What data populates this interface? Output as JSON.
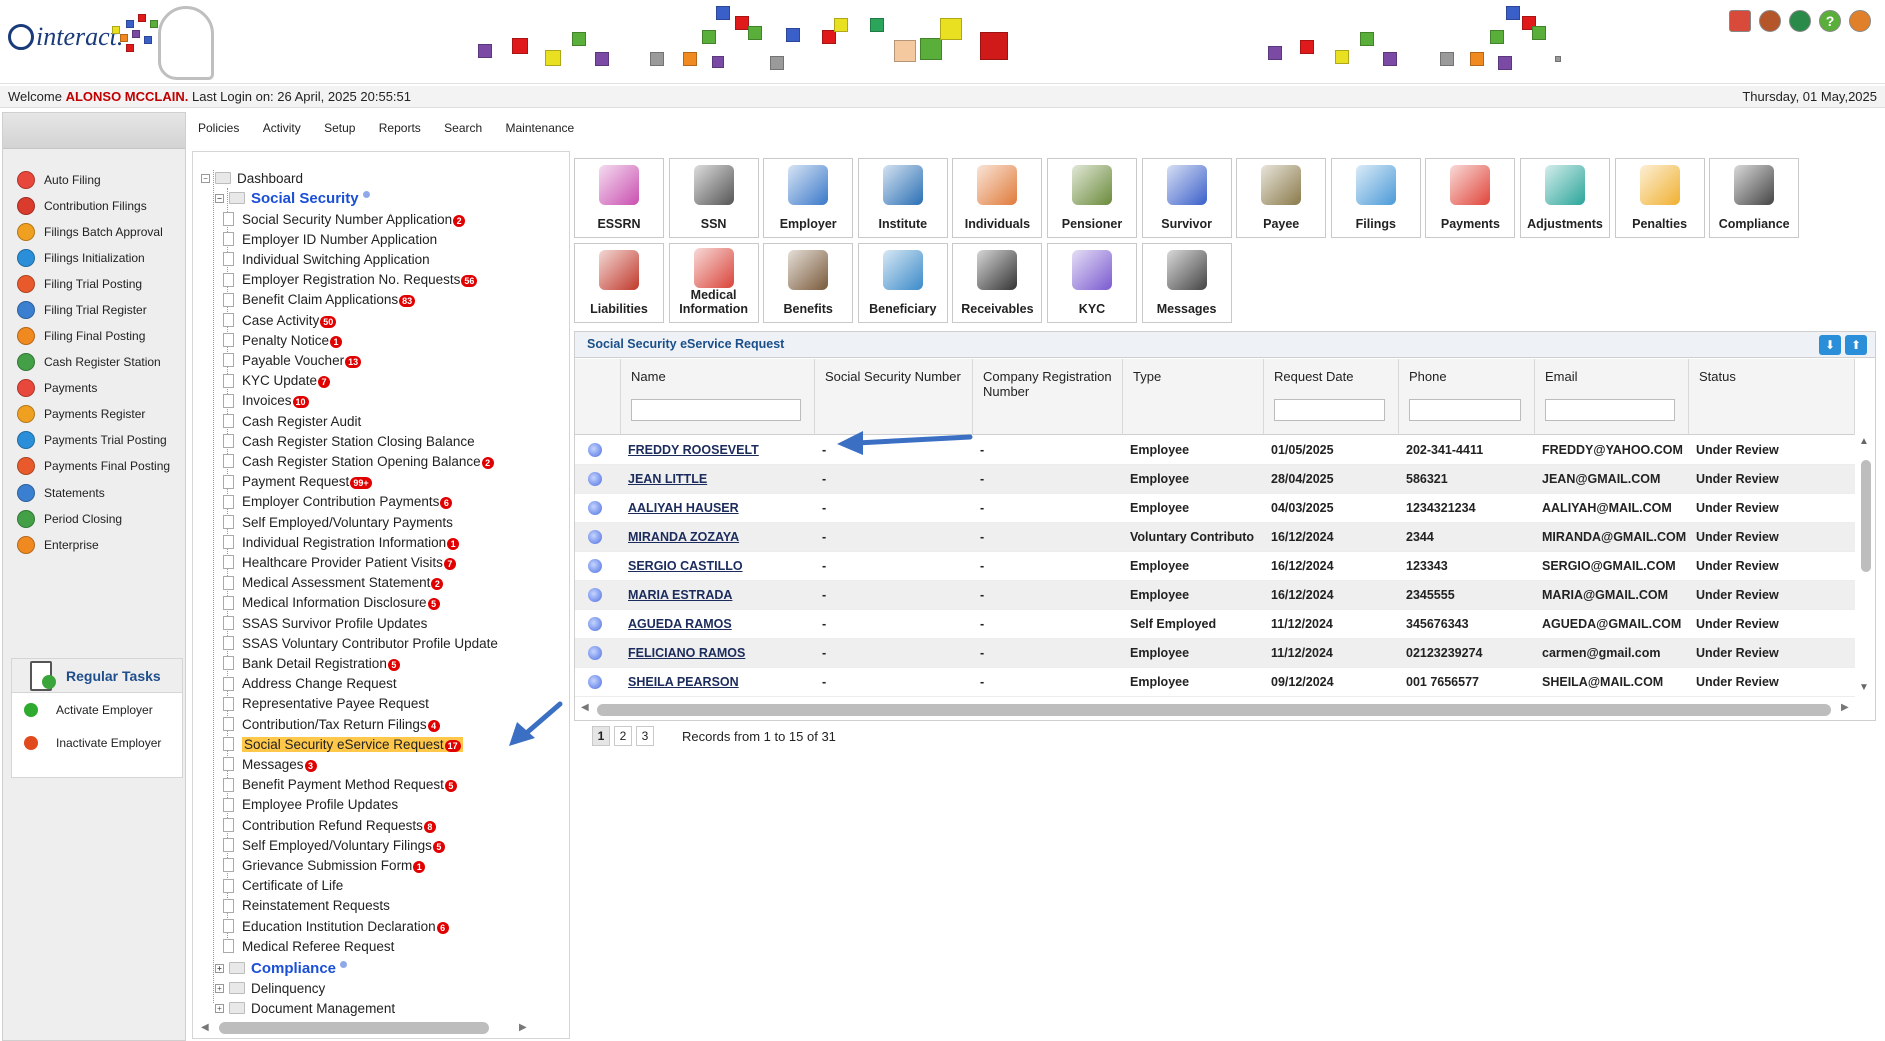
{
  "header": {
    "logo_text": "interact."
  },
  "welcome": {
    "prefix": "Welcome",
    "user": "ALONSO MCCLAIN.",
    "last_login": "Last Login on: 26 April, 2025 20:55:51",
    "today": "Thursday, 01 May,2025"
  },
  "menu": [
    "Policies",
    "Activity",
    "Setup",
    "Reports",
    "Search",
    "Maintenance"
  ],
  "sidebar": {
    "items": [
      {
        "label": "Auto Filing",
        "color": "#e8473c"
      },
      {
        "label": "Contribution Filings",
        "color": "#d93b2c"
      },
      {
        "label": "Filings Batch Approval",
        "color": "#f0a020"
      },
      {
        "label": "Filings Initialization",
        "color": "#2a8fd8"
      },
      {
        "label": "Filing Trial Posting",
        "color": "#e85a2c"
      },
      {
        "label": "Filing Trial Register",
        "color": "#3a7fd0"
      },
      {
        "label": "Filing Final Posting",
        "color": "#f08a20"
      },
      {
        "label": "Cash Register Station",
        "color": "#43a047"
      },
      {
        "label": "Payments",
        "color": "#e8473c"
      },
      {
        "label": "Payments Register",
        "color": "#f0a020"
      },
      {
        "label": "Payments Trial Posting",
        "color": "#2a8fd8"
      },
      {
        "label": "Payments Final Posting",
        "color": "#e85a2c"
      },
      {
        "label": "Statements",
        "color": "#3a7fd0"
      },
      {
        "label": "Period Closing",
        "color": "#43a047"
      },
      {
        "label": "Enterprise",
        "color": "#f08a20"
      }
    ],
    "regular_tasks_title": "Regular Tasks",
    "regular_tasks": [
      {
        "label": "Activate Employer",
        "color": "#2eaa2e"
      },
      {
        "label": "Inactivate Employer",
        "color": "#e04a1c"
      }
    ]
  },
  "tree": {
    "root": "Dashboard",
    "section": "Social Security",
    "items": [
      {
        "label": "Social Security Number Application",
        "badge": "2"
      },
      {
        "label": "Employer ID Number Application",
        "badge": ""
      },
      {
        "label": "Individual Switching Application",
        "badge": ""
      },
      {
        "label": "Employer Registration No. Requests",
        "badge": "56"
      },
      {
        "label": "Benefit Claim Applications",
        "badge": "83"
      },
      {
        "label": "Case Activity",
        "badge": "50"
      },
      {
        "label": "Penalty Notice",
        "badge": "1"
      },
      {
        "label": "Payable Voucher",
        "badge": "13"
      },
      {
        "label": "KYC Update",
        "badge": "7"
      },
      {
        "label": "Invoices",
        "badge": "10"
      },
      {
        "label": "Cash Register Audit",
        "badge": ""
      },
      {
        "label": "Cash Register Station Closing Balance",
        "badge": ""
      },
      {
        "label": "Cash Register Station Opening Balance",
        "badge": "2"
      },
      {
        "label": "Payment Request",
        "badge": "99+"
      },
      {
        "label": "Employer Contribution Payments",
        "badge": "6"
      },
      {
        "label": "Self Employed/Voluntary Payments",
        "badge": ""
      },
      {
        "label": "Individual Registration Information",
        "badge": "1"
      },
      {
        "label": "Healthcare Provider Patient Visits",
        "badge": "7"
      },
      {
        "label": "Medical Assessment Statement",
        "badge": "2"
      },
      {
        "label": "Medical Information Disclosure",
        "badge": "5"
      },
      {
        "label": "SSAS Survivor Profile Updates",
        "badge": ""
      },
      {
        "label": "SSAS Voluntary Contributor Profile Update",
        "badge": ""
      },
      {
        "label": "Bank Detail Registration",
        "badge": "5"
      },
      {
        "label": "Address Change Request",
        "badge": ""
      },
      {
        "label": "Representative Payee Request",
        "badge": ""
      },
      {
        "label": "Contribution/Tax Return Filings",
        "badge": "4"
      },
      {
        "label": "Social Security eService Request",
        "badge": "17"
      },
      {
        "label": "Messages",
        "badge": "3"
      },
      {
        "label": "Benefit Payment Method Request",
        "badge": "5"
      },
      {
        "label": "Employee Profile Updates",
        "badge": ""
      },
      {
        "label": "Contribution Refund Requests",
        "badge": "8"
      },
      {
        "label": "Self Employed/Voluntary Filings",
        "badge": "5"
      },
      {
        "label": "Grievance Submission Form",
        "badge": "1"
      },
      {
        "label": "Certificate of Life",
        "badge": ""
      },
      {
        "label": "Reinstatement Requests",
        "badge": ""
      },
      {
        "label": "Education Institution Declaration",
        "badge": "6"
      },
      {
        "label": "Medical Referee Request",
        "badge": ""
      }
    ],
    "sections_after": [
      "Compliance",
      "Delinquency",
      "Document Management"
    ]
  },
  "tiles": [
    {
      "label": "ESSRN",
      "color": "#c94fb0"
    },
    {
      "label": "SSN",
      "color": "#555555"
    },
    {
      "label": "Employer",
      "color": "#3a78c9"
    },
    {
      "label": "Institute",
      "color": "#2a6fb5"
    },
    {
      "label": "Individuals",
      "color": "#e07a3a"
    },
    {
      "label": "Pensioner",
      "color": "#6a8a3a"
    },
    {
      "label": "Survivor",
      "color": "#3a5fc9"
    },
    {
      "label": "Payee",
      "color": "#8a7a4a"
    },
    {
      "label": "Filings",
      "color": "#4a9ad8"
    },
    {
      "label": "Payments",
      "color": "#e0453a"
    },
    {
      "label": "Adjustments",
      "color": "#2aa59a"
    },
    {
      "label": "Penalties",
      "color": "#f0b030"
    },
    {
      "label": "Compliance",
      "color": "#444444"
    },
    {
      "label": "Liabilities",
      "color": "#c0392b"
    },
    {
      "label": "Medical Information",
      "color": "#d9443a"
    },
    {
      "label": "Benefits",
      "color": "#7a5a3a"
    },
    {
      "label": "Beneficiary",
      "color": "#3a8ac9"
    },
    {
      "label": "Receivables",
      "color": "#333333"
    },
    {
      "label": "KYC",
      "color": "#7a5ad0"
    },
    {
      "label": "Messages",
      "color": "#444444"
    }
  ],
  "grid": {
    "title": "Social Security eService Request",
    "columns": [
      "Name",
      "Social Security Number",
      "Company Registration Number",
      "Type",
      "Request Date",
      "Phone",
      "Email",
      "Status"
    ],
    "rows": [
      {
        "name": "FREDDY ROOSEVELT",
        "ssn": "-",
        "crn": "-",
        "type": "Employee",
        "date": "01/05/2025",
        "phone": "202-341-4411",
        "email": "FREDDY@YAHOO.COM",
        "status": "Under Review"
      },
      {
        "name": "JEAN LITTLE",
        "ssn": "-",
        "crn": "-",
        "type": "Employee",
        "date": "28/04/2025",
        "phone": "586321",
        "email": "JEAN@GMAIL.COM",
        "status": "Under Review"
      },
      {
        "name": "AALIYAH HAUSER",
        "ssn": "-",
        "crn": "-",
        "type": "Employee",
        "date": "04/03/2025",
        "phone": "1234321234",
        "email": "AALIYAH@MAIL.COM",
        "status": "Under Review"
      },
      {
        "name": "MIRANDA ZOZAYA",
        "ssn": "-",
        "crn": "-",
        "type": "Voluntary Contributo",
        "date": "16/12/2024",
        "phone": "2344",
        "email": "MIRANDA@GMAIL.COM",
        "status": "Under Review"
      },
      {
        "name": "SERGIO CASTILLO",
        "ssn": "-",
        "crn": "-",
        "type": "Employee",
        "date": "16/12/2024",
        "phone": "123343",
        "email": "SERGIO@GMAIL.COM",
        "status": "Under Review"
      },
      {
        "name": "MARIA ESTRADA",
        "ssn": "-",
        "crn": "-",
        "type": "Employee",
        "date": "16/12/2024",
        "phone": "2345555",
        "email": "MARIA@GMAIL.COM",
        "status": "Under Review"
      },
      {
        "name": "AGUEDA RAMOS",
        "ssn": "-",
        "crn": "-",
        "type": "Self Employed",
        "date": "11/12/2024",
        "phone": "345676343",
        "email": "AGUEDA@GMAIL.COM",
        "status": "Under Review"
      },
      {
        "name": "FELICIANO RAMOS",
        "ssn": "-",
        "crn": "-",
        "type": "Employee",
        "date": "11/12/2024",
        "phone": "02123239274",
        "email": "carmen@gmail.com",
        "status": "Under Review"
      },
      {
        "name": "SHEILA PEARSON",
        "ssn": "-",
        "crn": "-",
        "type": "Employee",
        "date": "09/12/2024",
        "phone": "001 7656577",
        "email": "SHEILA@MAIL.COM",
        "status": "Under Review"
      }
    ],
    "pages": [
      "1",
      "2",
      "3"
    ],
    "records_text": "Records from 1 to 15 of 31"
  }
}
